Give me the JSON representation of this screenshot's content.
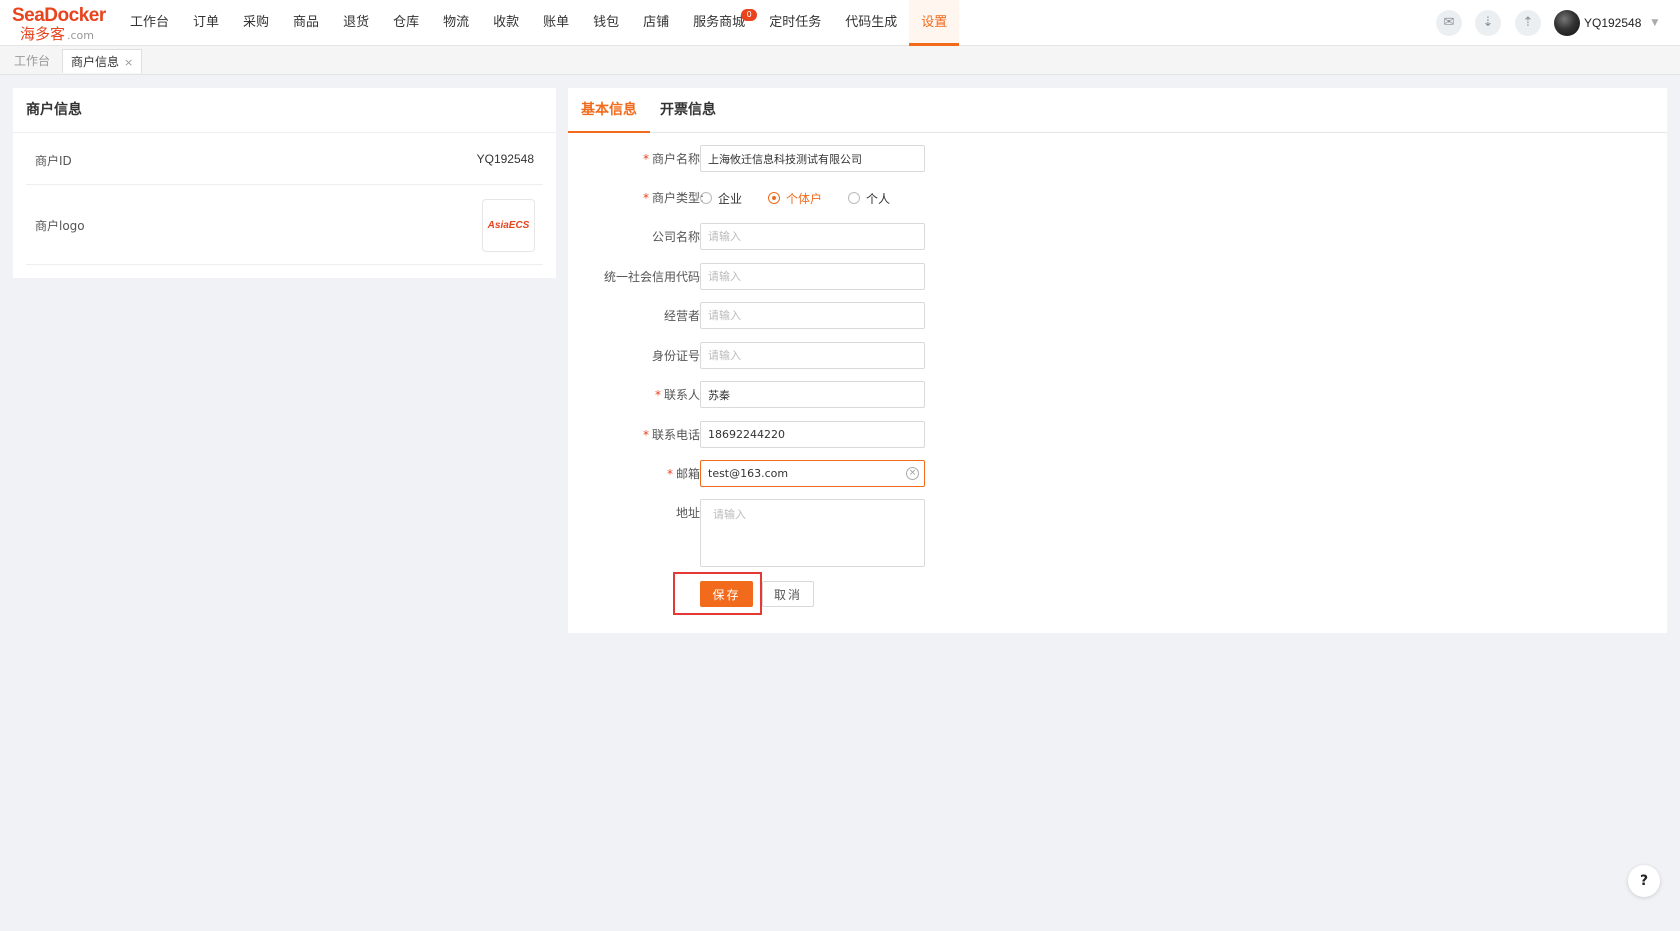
{
  "brand": {
    "name_en": "SeaDocker",
    "name_cn": "海多客",
    "domain": ".com"
  },
  "nav": {
    "items": [
      {
        "label": "工作台"
      },
      {
        "label": "订单"
      },
      {
        "label": "采购"
      },
      {
        "label": "商品"
      },
      {
        "label": "退货"
      },
      {
        "label": "仓库"
      },
      {
        "label": "物流"
      },
      {
        "label": "收款"
      },
      {
        "label": "账单"
      },
      {
        "label": "钱包"
      },
      {
        "label": "店铺"
      },
      {
        "label": "服务商城"
      },
      {
        "label": "定时任务"
      },
      {
        "label": "代码生成"
      },
      {
        "label": "设置"
      }
    ],
    "active": "设置",
    "badge": "0"
  },
  "toolbar_icons": [
    "announcement-icon",
    "download-icon",
    "upload-icon"
  ],
  "user": {
    "name": "YQ192548"
  },
  "tabs_strip": {
    "home": "工作台",
    "current": "商户信息",
    "close": "×"
  },
  "merchant_card": {
    "title": "商户信息",
    "id_label": "商户ID",
    "id_value": "YQ192548",
    "logo_label": "商户logo",
    "logo_text": "AsiaECS"
  },
  "form_tabs": {
    "basic": "基本信息",
    "invoice": "开票信息"
  },
  "form": {
    "required_mark": "*",
    "merchant_name": {
      "label": "商户名称:",
      "value": "上海攸迁信息科技测试有限公司"
    },
    "merchant_type": {
      "label": "商户类型:",
      "options": [
        "企业",
        "个体户",
        "个人"
      ],
      "selected": "个体户"
    },
    "company_name": {
      "label": "公司名称:",
      "placeholder": "请输入"
    },
    "credit_code": {
      "label": "统一社会信用代码:",
      "placeholder": "请输入"
    },
    "operator": {
      "label": "经营者:",
      "placeholder": "请输入"
    },
    "id_number": {
      "label": "身份证号:",
      "placeholder": "请输入"
    },
    "contact": {
      "label": "联系人:",
      "value": "苏秦"
    },
    "phone": {
      "label": "联系电话:",
      "value": "18692244220"
    },
    "email": {
      "label": "邮箱:",
      "value": "test@163.com"
    },
    "address": {
      "label": "地址:",
      "placeholder": "请输入"
    },
    "save": "保存",
    "cancel": "取消"
  },
  "help": "?",
  "colors": {
    "accent": "#f26b1d",
    "brand": "#e8441e",
    "highlight": "#e53935"
  }
}
